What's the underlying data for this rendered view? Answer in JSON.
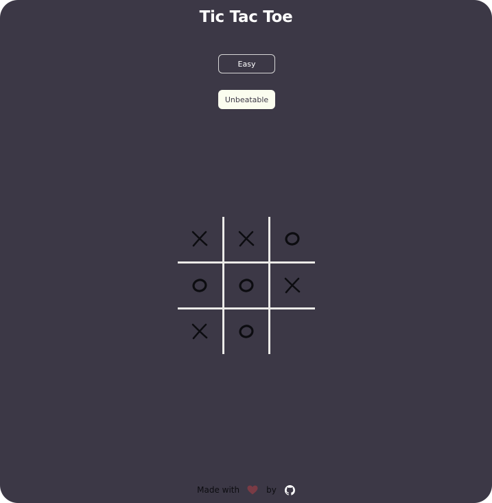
{
  "header": {
    "title": "Tic Tac Toe"
  },
  "modes": [
    {
      "label": "Easy",
      "selected": false
    },
    {
      "label": "Unbeatable",
      "selected": true
    }
  ],
  "board": {
    "cells": [
      "X",
      "X",
      "O",
      "O",
      "O",
      "X",
      "X",
      "O",
      ""
    ]
  },
  "footer": {
    "made_with": "Made with",
    "by": "by",
    "heart_icon": "heart-icon",
    "github_icon": "github-icon"
  },
  "colors": {
    "background": "#3c3846",
    "grid_lines": "#ecebe8",
    "marks": "#0c0c10",
    "selected_button": "#fbfdef",
    "heart": "#7a3b45"
  }
}
